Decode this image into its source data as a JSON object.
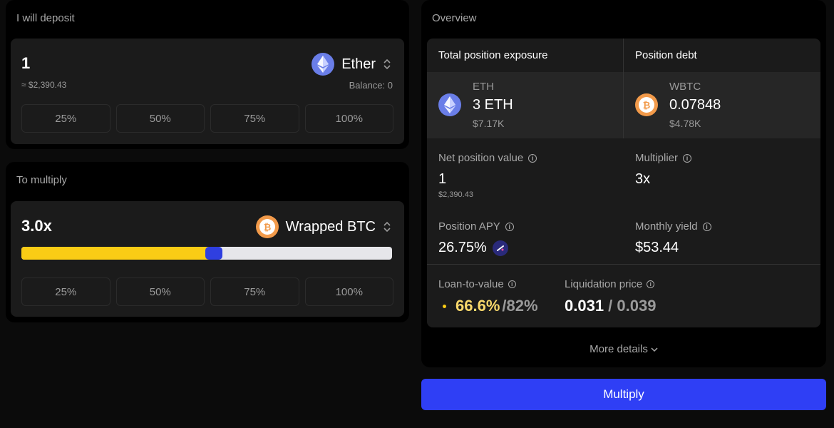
{
  "deposit": {
    "title": "I will deposit",
    "amount": "1",
    "usd": "≈ $2,390.43",
    "token": "Ether",
    "balance": "Balance: 0",
    "percents": [
      "25%",
      "50%",
      "75%",
      "100%"
    ]
  },
  "multiply": {
    "title": "To multiply",
    "multiplier": "3.0x",
    "token": "Wrapped BTC",
    "slider_fraction": 0.52,
    "percents": [
      "25%",
      "50%",
      "75%",
      "100%"
    ]
  },
  "overview": {
    "title": "Overview",
    "exposure_header": "Total position exposure",
    "debt_header": "Position debt",
    "exposure": {
      "symbol": "ETH",
      "amount": "3 ETH",
      "usd": "$7.17K"
    },
    "debt": {
      "symbol": "WBTC",
      "amount": "0.07848",
      "usd": "$4.78K"
    },
    "net_value_label": "Net position value",
    "net_value": "1",
    "net_value_usd": "$2,390.43",
    "multiplier_label": "Multiplier",
    "multiplier_value": "3x",
    "apy_label": "Position APY",
    "apy_value": "26.75%",
    "monthly_label": "Monthly yield",
    "monthly_value": "$53.44",
    "ltv_label": "Loan-to-value",
    "ltv_value": "66.6%",
    "ltv_max": "/82%",
    "liq_label": "Liquidation price",
    "liq_value": "0.031",
    "liq_sep": " / ",
    "liq_current": "0.039",
    "more_details": "More details"
  },
  "action": {
    "label": "Multiply"
  },
  "colors": {
    "accent": "#2f3ff5",
    "yellow": "#facc15",
    "eth": "#6a7ee8",
    "btc": "#f29a4a"
  }
}
